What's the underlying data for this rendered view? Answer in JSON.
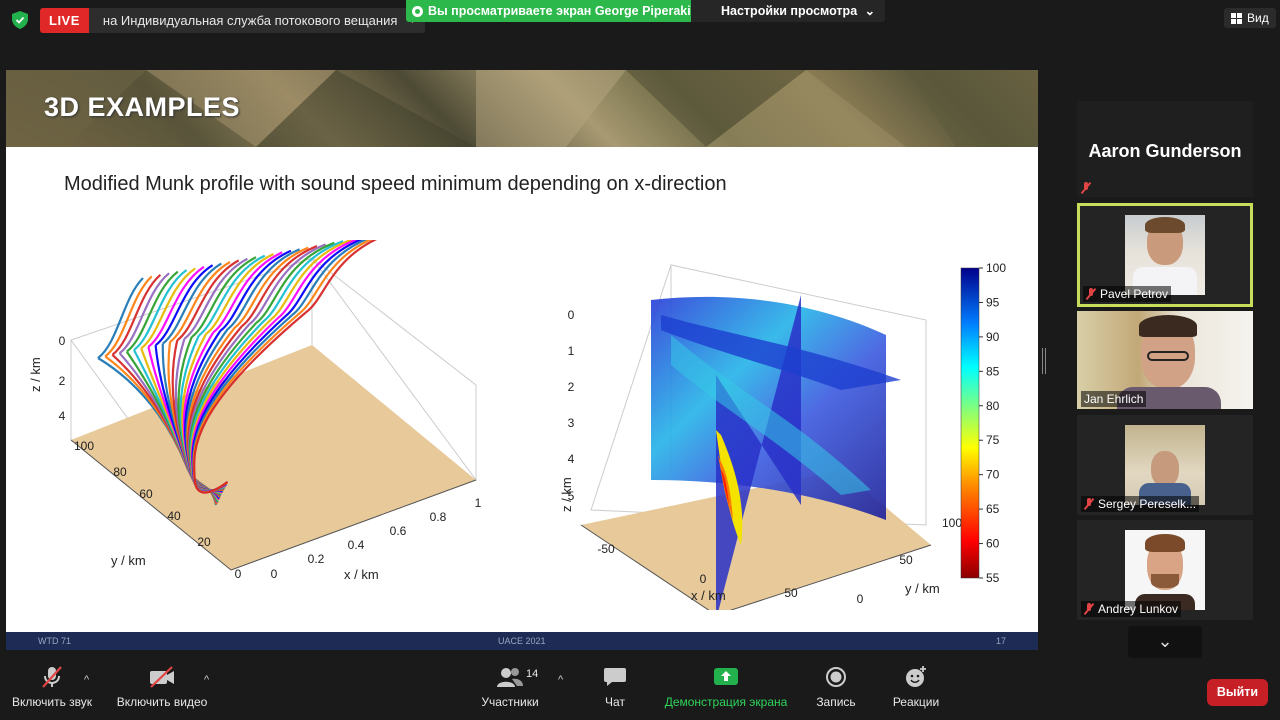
{
  "topbar": {
    "live_badge": "LIVE",
    "live_target": "на Индивидуальная служба потокового вещания",
    "live_caret": "▼",
    "share_notice": "Вы просматриваете экран George Piperakis",
    "view_options": "Настройки просмотра",
    "view_options_caret": "⌄",
    "view_label": "Вид"
  },
  "slide": {
    "title": "3D EXAMPLES",
    "subtitle": "Modified Munk profile with sound speed minimum depending on x-direction",
    "footer_left": "WTD 71",
    "footer_center": "UACE 2021",
    "footer_right": "17",
    "colors": {
      "floor": "#e7c99a",
      "footer": "#1e2c55",
      "accent": "#2db84b"
    }
  },
  "chart_data": [
    {
      "type": "line",
      "dimensions": 3,
      "xlabel": "x / km",
      "ylabel": "y / km",
      "zlabel": "z / km",
      "x_ticks": [
        "0",
        "0.2",
        "0.4",
        "0.6",
        "0.8",
        "1"
      ],
      "y_ticks": [
        "0",
        "20",
        "40",
        "60",
        "80",
        "100"
      ],
      "z_ticks": [
        "0",
        "2",
        "4"
      ],
      "xlim": [
        0,
        1
      ],
      "ylim": [
        0,
        100
      ],
      "zlim": [
        0,
        4
      ],
      "series_count": 30,
      "palette": [
        "#1f77b4",
        "#ff7f0e",
        "#d62728",
        "#9467bd",
        "#2ca02c",
        "#17becf",
        "#e6b800",
        "#ff00ff",
        "#0000ff"
      ]
    },
    {
      "type": "heatmap",
      "dimensions": 3,
      "xlabel": "x / km",
      "ylabel": "y / km",
      "zlabel": "z / km",
      "x_ticks": [
        "-50",
        "0",
        "50"
      ],
      "y_ticks": [
        "0",
        "50",
        "100"
      ],
      "z_ticks": [
        "0",
        "1",
        "2",
        "3",
        "4",
        "5"
      ],
      "xlim": [
        -50,
        50
      ],
      "ylim": [
        0,
        100
      ],
      "zlim": [
        0,
        5
      ],
      "colorbar_ticks": [
        "100",
        "95",
        "90",
        "85",
        "80",
        "75",
        "70",
        "65",
        "60",
        "55"
      ],
      "colorbar_range": [
        55,
        100
      ],
      "colormap": "jet"
    }
  ],
  "participants": [
    {
      "name": "Aaron Gunderson",
      "muted": true,
      "video": false
    },
    {
      "name": "Pavel Petrov",
      "muted": true,
      "video": true,
      "active_speaker": true
    },
    {
      "name": "Jan Ehrlich",
      "muted": false,
      "video": true
    },
    {
      "name": "Sergey Pereselk...",
      "muted": true,
      "video": true
    },
    {
      "name": "Andrey Lunkov",
      "muted": true,
      "video": true
    }
  ],
  "scroll_icon": "⌄",
  "toolbar": {
    "audio": "Включить звук",
    "video": "Включить видео",
    "participants": "Участники",
    "participants_count": "14",
    "chat": "Чат",
    "share": "Демонстрация экрана",
    "record": "Запись",
    "reactions": "Реакции",
    "leave": "Выйти",
    "caret": "^"
  }
}
